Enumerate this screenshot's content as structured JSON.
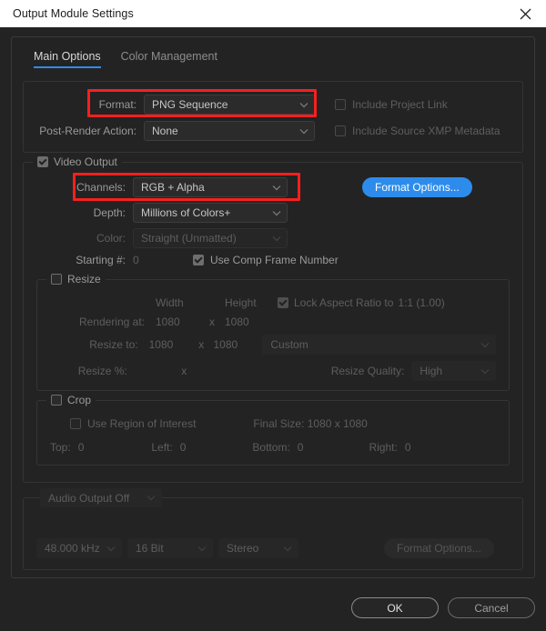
{
  "window": {
    "title": "Output Module Settings",
    "close_icon": "close-icon"
  },
  "tabs": [
    {
      "label": "Main Options",
      "active": true
    },
    {
      "label": "Color Management",
      "active": false
    }
  ],
  "format_section": {
    "format_label": "Format:",
    "format_value": "PNG Sequence",
    "post_render_label": "Post-Render Action:",
    "post_render_value": "None",
    "include_project_link": "Include Project Link",
    "include_xmp": "Include Source XMP Metadata"
  },
  "video_output": {
    "legend": "Video Output",
    "channels_label": "Channels:",
    "channels_value": "RGB + Alpha",
    "depth_label": "Depth:",
    "depth_value": "Millions of Colors+",
    "color_label": "Color:",
    "color_value": "Straight (Unmatted)",
    "starting_label": "Starting #:",
    "starting_value": "0",
    "use_comp_frame_number": "Use Comp Frame Number",
    "format_options_button": "Format Options..."
  },
  "resize": {
    "legend": "Resize",
    "width_header": "Width",
    "height_header": "Height",
    "lock_aspect": "Lock Aspect Ratio to",
    "lock_aspect_value": "1:1 (1.00)",
    "rendering_at_label": "Rendering at:",
    "rendering_width": "1080",
    "rendering_height": "1080",
    "resize_to_label": "Resize to:",
    "resize_to_width": "1080",
    "resize_to_height": "1080",
    "preset_value": "Custom",
    "resize_pct_label": "Resize %:",
    "resize_quality_label": "Resize Quality:",
    "resize_quality_value": "High",
    "times": "x"
  },
  "crop": {
    "legend": "Crop",
    "use_region_of_interest": "Use Region of Interest",
    "final_size": "Final Size: 1080 x 1080",
    "top_label": "Top:",
    "top_value": "0",
    "left_label": "Left:",
    "left_value": "0",
    "bottom_label": "Bottom:",
    "bottom_value": "0",
    "right_label": "Right:",
    "right_value": "0"
  },
  "audio": {
    "output_toggle": "Audio Output Off",
    "sample_rate": "48.000 kHz",
    "bit_depth": "16 Bit",
    "channels": "Stereo",
    "format_options_button": "Format Options..."
  },
  "footer": {
    "ok_label": "OK",
    "cancel_label": "Cancel"
  },
  "colors": {
    "accent_blue": "#2d8ceb",
    "highlight_red": "#f81f1f",
    "dialog_bg": "#232323",
    "titlebar_bg": "#ffffff"
  }
}
